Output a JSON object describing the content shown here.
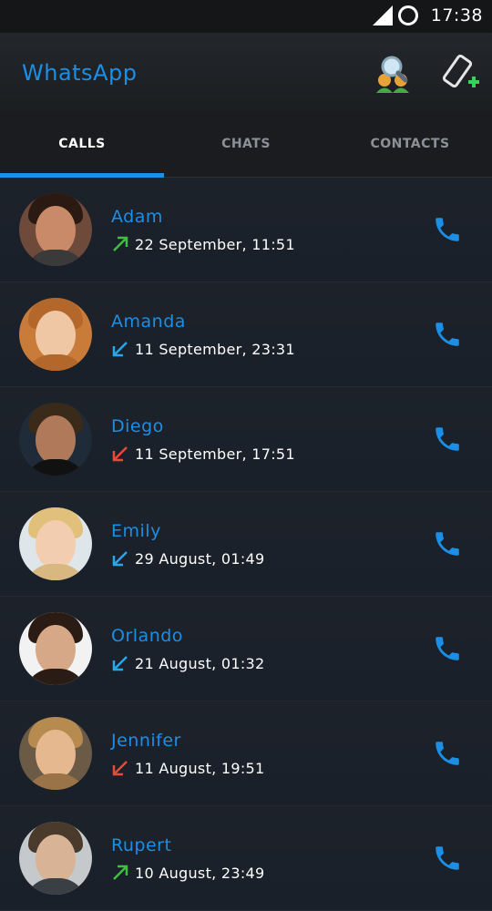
{
  "status_bar": {
    "time": "17:38"
  },
  "app_bar": {
    "title": "WhatsApp",
    "actions": [
      "search-contacts-icon",
      "new-call-icon"
    ]
  },
  "tabs": [
    {
      "label": "CALLS",
      "active": true
    },
    {
      "label": "CHATS",
      "active": false
    },
    {
      "label": "CONTACTS",
      "active": false
    }
  ],
  "colors": {
    "accent": "#1b8fe6",
    "outgoing": "#3fbf3f",
    "incoming_received": "#29a7e8",
    "missed": "#e84a3a"
  },
  "calls": [
    {
      "name": "Adam",
      "detail": "22 September, 11:51",
      "direction": "outgoing"
    },
    {
      "name": "Amanda",
      "detail": "11 September, 23:31",
      "direction": "incoming"
    },
    {
      "name": "Diego",
      "detail": "11 September, 17:51",
      "direction": "missed"
    },
    {
      "name": "Emily",
      "detail": "29 August, 01:49",
      "direction": "incoming"
    },
    {
      "name": "Orlando",
      "detail": "21 August, 01:32",
      "direction": "incoming"
    },
    {
      "name": "Jennifer",
      "detail": "11 August, 19:51",
      "direction": "missed"
    },
    {
      "name": "Rupert",
      "detail": "10 August, 23:49",
      "direction": "outgoing"
    }
  ]
}
